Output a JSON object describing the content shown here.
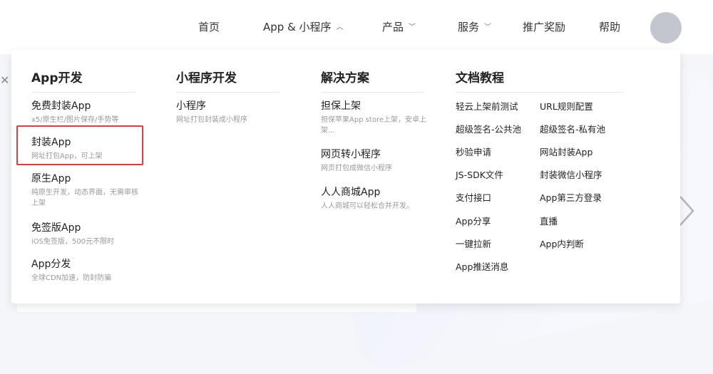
{
  "nav": {
    "home": "首页",
    "app_miniprogram": "App & 小程序",
    "products": "产品",
    "services": "服务",
    "promotion": "推广奖励",
    "help": "帮助"
  },
  "menu": {
    "app_dev": {
      "title": "App开发",
      "items": [
        {
          "title": "免费封装App",
          "desc": "x5/原生栏/图片保存/手势等"
        },
        {
          "title": "封装App",
          "desc": "网址打包App，可上架"
        },
        {
          "title": "原生App",
          "desc": "纯原生开发，动态界面，无需审核上架"
        },
        {
          "title": "免签版App",
          "desc": "iOS免签版，500元不限时"
        },
        {
          "title": "App分发",
          "desc": "全球CDN加速，防封防骗"
        }
      ]
    },
    "mini_dev": {
      "title": "小程序开发",
      "items": [
        {
          "title": "小程序",
          "desc": "网址打包封装成小程序"
        }
      ]
    },
    "solutions": {
      "title": "解决方案",
      "items": [
        {
          "title": "担保上架",
          "desc": "担保苹果App store上架，安卓上架..."
        },
        {
          "title": "网页转小程序",
          "desc": "网页打包成微信小程序"
        },
        {
          "title": "人人商城App",
          "desc": "人人商城可以轻松合并开发。"
        }
      ]
    },
    "docs": {
      "title": "文档教程",
      "left": [
        "轻云上架前测试",
        "超级签名-公共池",
        "秒验申请",
        "JS-SDK文件",
        "支付接口",
        "App分享",
        "一键拉新",
        "App推送消息"
      ],
      "right": [
        "URL规则配置",
        "超级签名-私有池",
        "网站封装App",
        "封装微信小程序",
        "App第三方登录",
        "直播",
        "App内判断"
      ]
    }
  },
  "colors": {
    "highlight": "#e23b3b",
    "avatar": "#c3c6cf"
  }
}
